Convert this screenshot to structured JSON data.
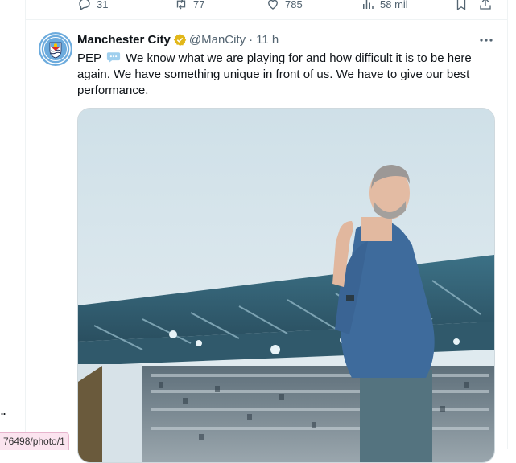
{
  "previous_tweet_actions": {
    "replies": "31",
    "retweets": "77",
    "likes": "785",
    "views": "58 mil"
  },
  "tweet": {
    "author_name": "Manchester City",
    "handle": "@ManCity",
    "separator": "·",
    "time": "11 h",
    "text_prefix": "PEP",
    "text_body": "We know what we are playing for and how difficult it is to be here again. We have something unique in front of us. We have to give our best performance."
  },
  "left_column": {
    "ellipsis": "..",
    "status_url": "76498/photo/1"
  },
  "colors": {
    "city_blue": "#6cabdd",
    "verified_gold": "#e2b719",
    "muted": "#536471"
  },
  "icons": [
    "reply-icon",
    "retweet-icon",
    "like-icon",
    "views-icon",
    "bookmark-icon",
    "share-icon",
    "verified-badge-icon",
    "more-icon",
    "speech-bubble-icon",
    "club-crest-icon"
  ]
}
